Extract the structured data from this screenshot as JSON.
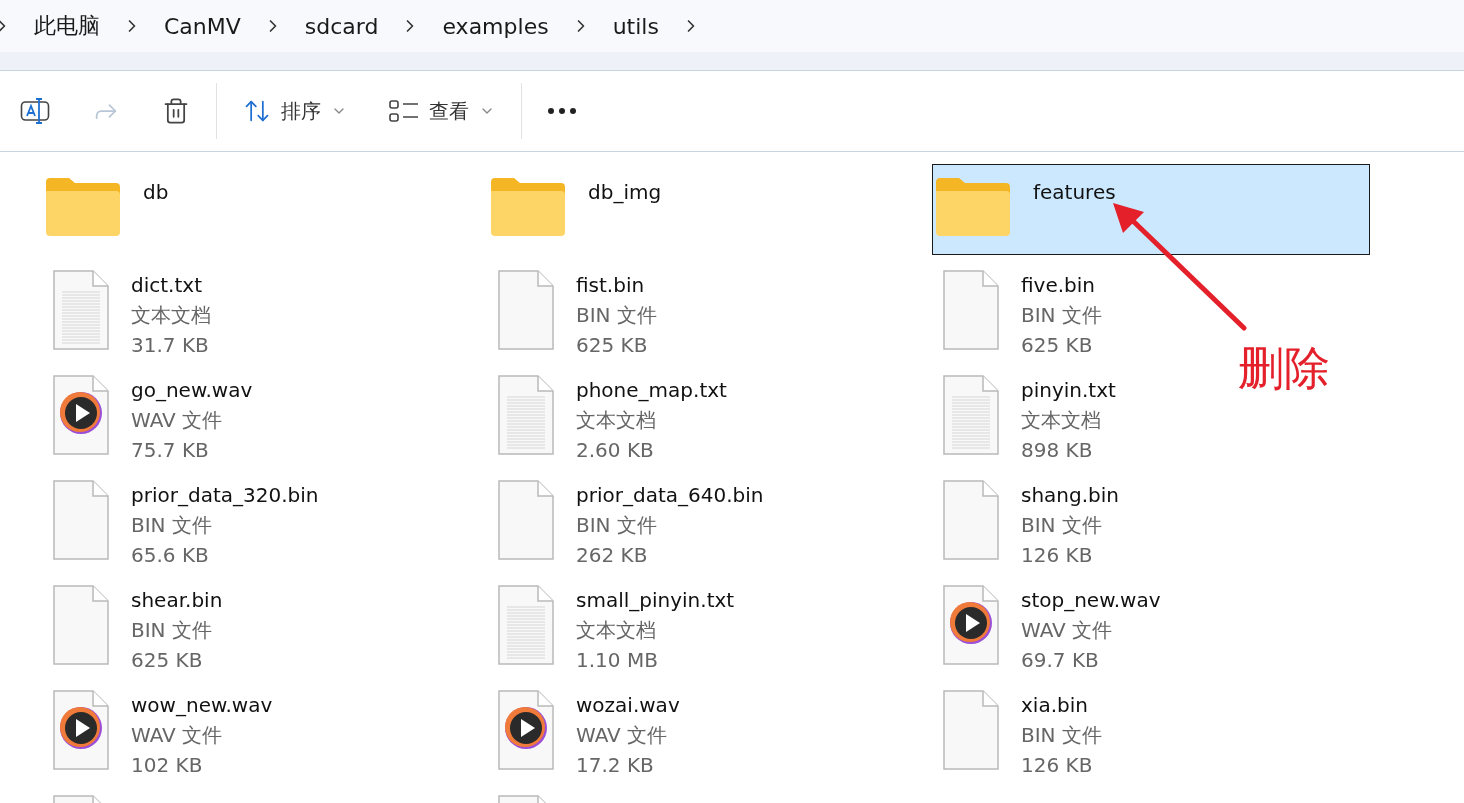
{
  "breadcrumb": [
    "此电脑",
    "CanMV",
    "sdcard",
    "examples",
    "utils"
  ],
  "toolbar": [
    {
      "kind": "rename",
      "disabled": false
    },
    {
      "kind": "share",
      "disabled": true
    },
    {
      "kind": "delete",
      "disabled": false
    },
    {
      "kind": "sort",
      "label": "排序",
      "disabled": false
    },
    {
      "kind": "view",
      "label": "查看",
      "disabled": false
    },
    {
      "kind": "more",
      "disabled": false
    }
  ],
  "items": [
    {
      "kind": "folder",
      "name": "db",
      "selected": false
    },
    {
      "kind": "folder",
      "name": "db_img",
      "selected": false
    },
    {
      "kind": "folder",
      "name": "features",
      "selected": true
    },
    {
      "kind": "txt",
      "name": "dict.txt",
      "type": "文本文档",
      "size": "31.7 KB",
      "selected": false
    },
    {
      "kind": "bin",
      "name": "fist.bin",
      "type": "BIN 文件",
      "size": "625 KB",
      "selected": false
    },
    {
      "kind": "bin",
      "name": "five.bin",
      "type": "BIN 文件",
      "size": "625 KB",
      "selected": false
    },
    {
      "kind": "wav",
      "name": "go_new.wav",
      "type": "WAV 文件",
      "size": "75.7 KB",
      "selected": false
    },
    {
      "kind": "txt",
      "name": "phone_map.txt",
      "type": "文本文档",
      "size": "2.60 KB",
      "selected": false
    },
    {
      "kind": "txt",
      "name": "pinyin.txt",
      "type": "文本文档",
      "size": "898 KB",
      "selected": false
    },
    {
      "kind": "bin",
      "name": "prior_data_320.bin",
      "type": "BIN 文件",
      "size": "65.6 KB",
      "selected": false
    },
    {
      "kind": "bin",
      "name": "prior_data_640.bin",
      "type": "BIN 文件",
      "size": "262 KB",
      "selected": false
    },
    {
      "kind": "bin",
      "name": "shang.bin",
      "type": "BIN 文件",
      "size": "126 KB",
      "selected": false
    },
    {
      "kind": "bin",
      "name": "shear.bin",
      "type": "BIN 文件",
      "size": "625 KB",
      "selected": false
    },
    {
      "kind": "txt",
      "name": "small_pinyin.txt",
      "type": "文本文档",
      "size": "1.10 MB",
      "selected": false
    },
    {
      "kind": "wav",
      "name": "stop_new.wav",
      "type": "WAV 文件",
      "size": "69.7 KB",
      "selected": false
    },
    {
      "kind": "wav",
      "name": "wow_new.wav",
      "type": "WAV 文件",
      "size": "102 KB",
      "selected": false
    },
    {
      "kind": "wav",
      "name": "wozai.wav",
      "type": "WAV 文件",
      "size": "17.2 KB",
      "selected": false
    },
    {
      "kind": "bin",
      "name": "xia.bin",
      "type": "BIN 文件",
      "size": "126 KB",
      "selected": false
    },
    {
      "kind": "bin",
      "selected": false
    },
    {
      "kind": "bin",
      "selected": false
    }
  ],
  "annotation": {
    "label": "删除"
  }
}
